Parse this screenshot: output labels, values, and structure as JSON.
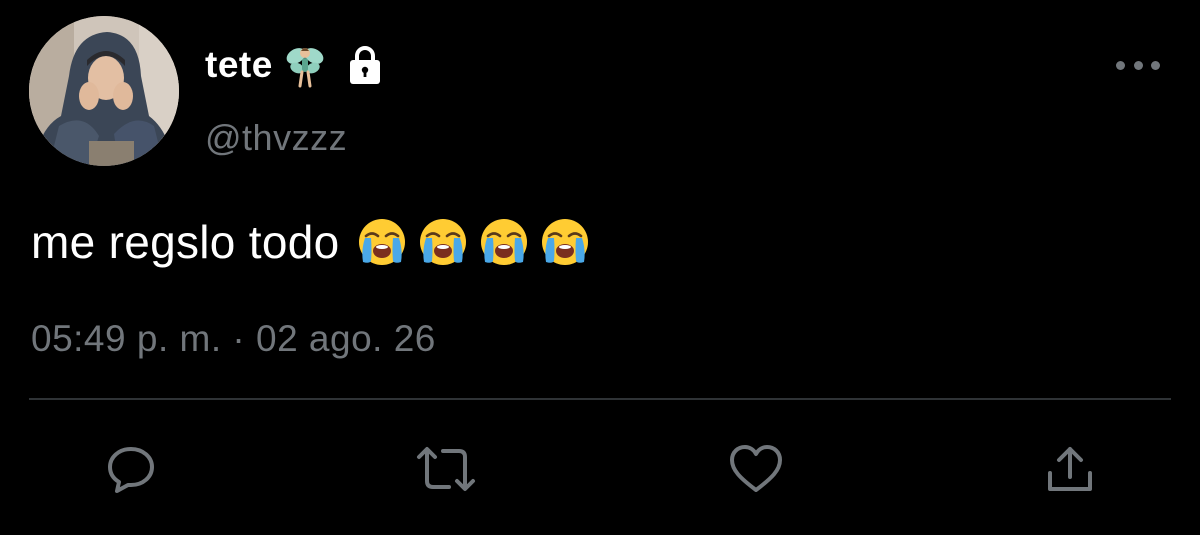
{
  "author": {
    "display_name": "tete",
    "handle": "@thvzzz",
    "badges": [
      "fairy-emoji",
      "lock-icon"
    ]
  },
  "tweet": {
    "text": "me regslo todo",
    "emojis": [
      "loudly-crying-face",
      "loudly-crying-face",
      "loudly-crying-face",
      "loudly-crying-face"
    ],
    "timestamp": "05:49 p. m. · 02 ago. 26"
  },
  "actions": [
    "reply-icon",
    "retweet-icon",
    "like-icon",
    "share-icon"
  ],
  "colors": {
    "background": "#000000",
    "text": "#ffffff",
    "muted": "#71767b",
    "divider": "#2f3336",
    "emoji_face": "#ffcc33",
    "emoji_tears": "#4aa8e8"
  }
}
